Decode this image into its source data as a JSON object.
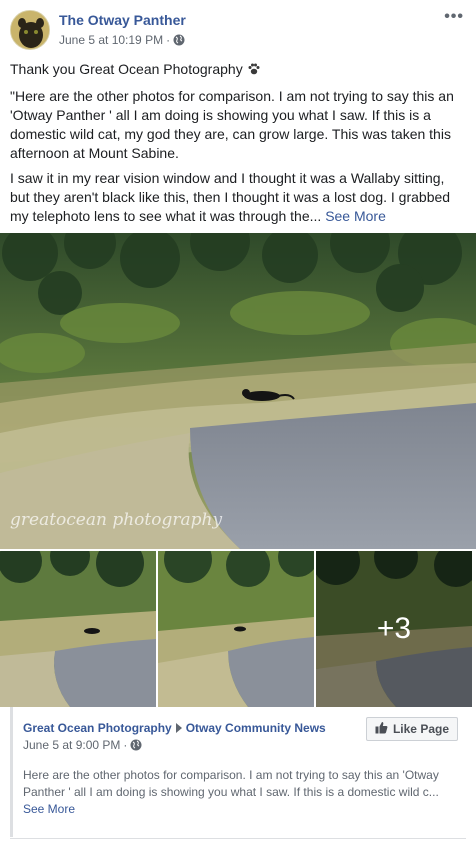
{
  "post": {
    "page_name": "The Otway Panther",
    "timestamp": "June 5 at 10:19 PM",
    "separator": "·",
    "privacy_icon": "globe-icon",
    "more_label": "•••",
    "line1": "Thank you Great Ocean Photography",
    "paw_icon": "paw-icon",
    "paragraph1": "\"Here are the other photos for comparison. I am not trying to say this an 'Otway Panther ' all I am doing is showing you what I saw. If this is a domestic wild cat, my god they are, can grow large. This was taken this afternoon at Mount Sabine.",
    "paragraph2": "I saw it in my rear vision window and I thought it was a Wallaby sitting, but they aren't black like this, then I thought it was a lost dog. I grabbed my telephoto lens to see what it was through the...",
    "see_more": "See More"
  },
  "photos": {
    "watermark": "greatocean photography",
    "extra_count": "+3"
  },
  "shared": {
    "source": "Great Ocean Photography",
    "target": "Otway Community News",
    "timestamp": "June 5 at 9:00 PM",
    "separator": "·",
    "like_button": "Like Page",
    "text": "Here are the other photos for comparison. I am not trying to say this an 'Otway Panther ' all I am doing is showing you what I saw. If this is a domestic wild c...",
    "see_more": "See More"
  },
  "colors": {
    "link": "#385898",
    "meta": "#606770",
    "text": "#1c1e21"
  }
}
